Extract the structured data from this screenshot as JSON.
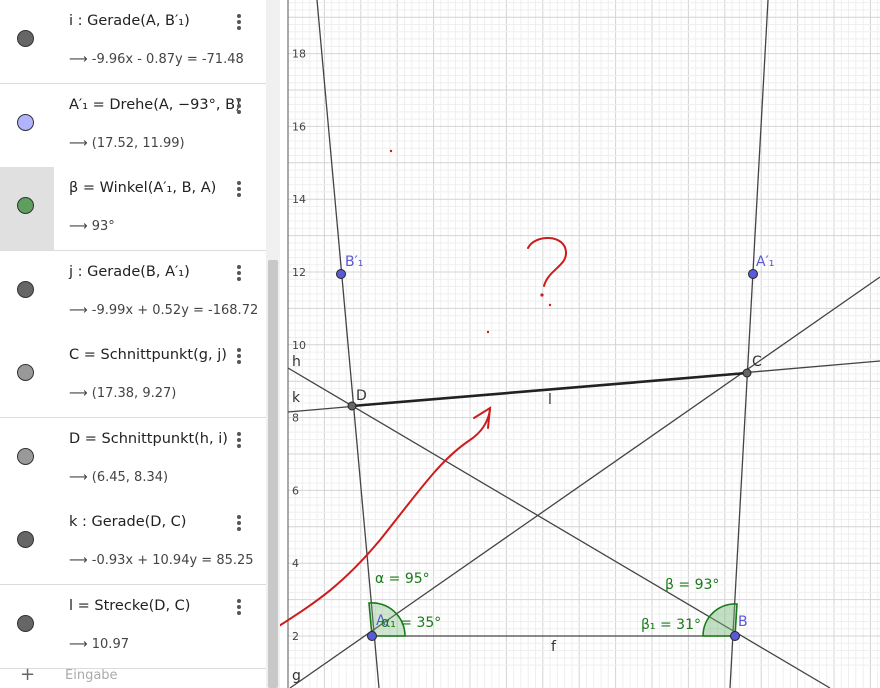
{
  "algebra": {
    "rows": [
      {
        "name": "row-i",
        "defn": "i : Gerade(A, B′₁)",
        "value": "⟶ -9.96x - 0.87y = -71.48",
        "color": "#666666",
        "selected": false
      },
      {
        "name": "row-a1prime",
        "defn": "A′₁ = Drehe(A, −93°, B)",
        "value": "⟶ (17.52, 11.99)",
        "color": "#b0b4ff",
        "selected": false
      },
      {
        "name": "row-beta",
        "defn": "β = Winkel(A′₁, B, A)",
        "value": "⟶ 93°",
        "color": "#5e9e5e",
        "selected": true
      },
      {
        "name": "row-j",
        "defn": "j : Gerade(B, A′₁)",
        "value": "⟶ -9.99x + 0.52y = -168.72",
        "color": "#666666",
        "selected": false
      },
      {
        "name": "row-c",
        "defn": "C = Schnittpunkt(g, j)",
        "value": "⟶ (17.38, 9.27)",
        "color": "#999999",
        "selected": false
      },
      {
        "name": "row-d",
        "defn": "D = Schnittpunkt(h, i)",
        "value": "⟶ (6.45, 8.34)",
        "color": "#999999",
        "selected": false
      },
      {
        "name": "row-k",
        "defn": "k : Gerade(D, C)",
        "value": "⟶ -0.93x + 10.94y = 85.25",
        "color": "#666666",
        "selected": false
      },
      {
        "name": "row-l",
        "defn": "l = Strecke(D, C)",
        "value": "⟶ 10.97",
        "color": "#666666",
        "selected": false
      }
    ],
    "input_plus": "+",
    "input_placeholder": "Eingabe"
  },
  "graphics": {
    "y_ticks": [
      "18",
      "16",
      "14",
      "12",
      "10",
      "8",
      "6",
      "4",
      "2"
    ],
    "points": {
      "A": "A",
      "B": "B",
      "C": "C",
      "D": "D",
      "A1p": "A′₁",
      "B1p": "B′₁"
    },
    "line_labels": {
      "h": "h",
      "k": "k",
      "g": "g",
      "l": "l",
      "f": "f"
    },
    "angles": {
      "alpha": "α = 95°",
      "alpha1": "α₁ = 35°",
      "beta": "β = 93°",
      "beta1": "β₁ = 31°"
    },
    "annotation": "?",
    "colors": {
      "point_blue": "#5a5ad6",
      "point_dark": "#333333",
      "angle_green": "#1a7a1a",
      "ink_red": "#cc1c1c",
      "grid": "#e6e6e6",
      "axis": "#555555"
    }
  }
}
